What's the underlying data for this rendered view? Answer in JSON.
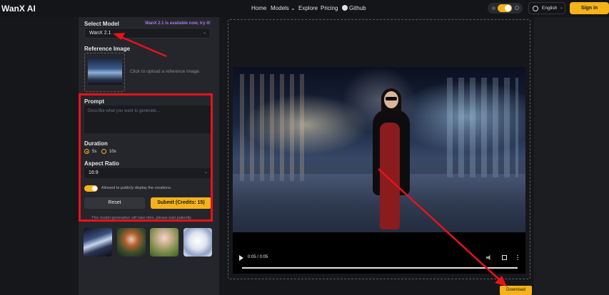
{
  "header": {
    "logo": "WanX AI",
    "nav": [
      {
        "label": "Home"
      },
      {
        "label": "Models ⌄"
      },
      {
        "label": "Explore"
      },
      {
        "label": "Pricing"
      },
      {
        "label": "Github"
      }
    ],
    "language": "English",
    "signin_label": "Sign in"
  },
  "form": {
    "select_model_label": "Select Model",
    "notice": "WanX 2.1 is available now, try it!",
    "model_value": "WanX 2.1",
    "reference_label": "Reference Image",
    "reference_hint": "Click to upload a reference image.",
    "prompt_label": "Prompt",
    "prompt_placeholder": "Describe what you want to generate...",
    "duration_label": "Duration",
    "durations": [
      {
        "label": "5s",
        "selected": true
      },
      {
        "label": "10s",
        "selected": false
      }
    ],
    "aspect_label": "Aspect Ratio",
    "aspect_value": "16:9",
    "public_label": "Allowed to publicly display the creations.",
    "reset_label": "Reset",
    "submit_label": "Submit (Credits: 15)",
    "generation_note": "This model generation will take time, please wait patiently"
  },
  "video": {
    "time": "0:05 / 0:05",
    "progress": 1.0
  },
  "download_label": "Download",
  "colors": {
    "accent": "#f5b21b",
    "annotation": "#e8121b",
    "notice": "#a67cf2"
  }
}
